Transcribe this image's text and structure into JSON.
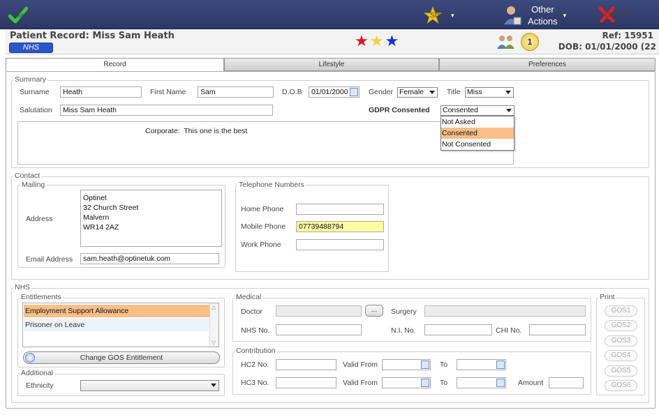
{
  "toolbar": {
    "save": "Save",
    "stars": "Stars",
    "other_actions_line1": "Other",
    "other_actions_line2": "Actions",
    "cancel": "Cancel"
  },
  "header": {
    "title": "Patient Record: Miss Sam Heath",
    "badge": "NHS",
    "ref": "Ref: 15951",
    "dob": "DOB: 01/01/2000 (22",
    "notification_count": "1",
    "star_colors": [
      "#e8121c",
      "#f2d33a",
      "#1a2fd6"
    ]
  },
  "tabs": [
    "Record",
    "Lifestyle",
    "Preferences"
  ],
  "summary": {
    "legend": "Summary",
    "surname_label": "Surname",
    "surname": "Heath",
    "firstname_label": "First Name",
    "firstname": "Sam",
    "dob_label": "D.O.B",
    "dob": "01/01/2000",
    "gender_label": "Gender",
    "gender": "Female",
    "title_label": "Title",
    "title": "Miss",
    "salutation_label": "Salutation",
    "salutation": "Miss Sam Heath",
    "gdpr_label": "GDPR Consented",
    "gdpr": "Consented",
    "gdpr_options": [
      "Not Asked",
      "Consented",
      "Not Consented"
    ],
    "corporate_label": "Corporate:",
    "corporate": "This one is the best"
  },
  "contact": {
    "legend": "Contact",
    "mailing_legend": "Mailing",
    "address_label": "Address",
    "address_lines": [
      "Optinet",
      "32 Church Street",
      "Malvern",
      "WR14 2AZ"
    ],
    "email_label": "Email Address",
    "email": "sam.heath@optinetuk.com",
    "phone_legend": "Telephone Numbers",
    "home_label": "Home Phone",
    "home": "",
    "mobile_label": "Mobile Phone",
    "mobile": "07739488794",
    "work_label": "Work Phone",
    "work": ""
  },
  "nhs": {
    "legend": "NHS",
    "entitlements_legend": "Entitlements",
    "entitlements": [
      "Employment Support Allowance",
      "Prisoner on Leave"
    ],
    "change_button": "Change GOS Entitlement",
    "additional_legend": "Additional",
    "ethnicity_label": "Ethnicity",
    "ethnicity": "",
    "medical_legend": "Medical",
    "doctor_label": "Doctor",
    "doctor_button": "...",
    "surgery_label": "Surgery",
    "nhs_no_label": "NHS No.",
    "ni_no_label": "N.I. No.",
    "chi_no_label": "CHI No.",
    "contribution_legend": "Contribution",
    "hc2_label": "HC2 No.",
    "hc3_label": "HC3 No.",
    "valid_from_label": "Valid From",
    "to_label": "To",
    "amount_label": "Amount",
    "print_legend": "Print",
    "print_buttons": [
      "GOS1",
      "GOS2",
      "GOS3",
      "GOS4",
      "GOS5",
      "GOS6"
    ]
  }
}
